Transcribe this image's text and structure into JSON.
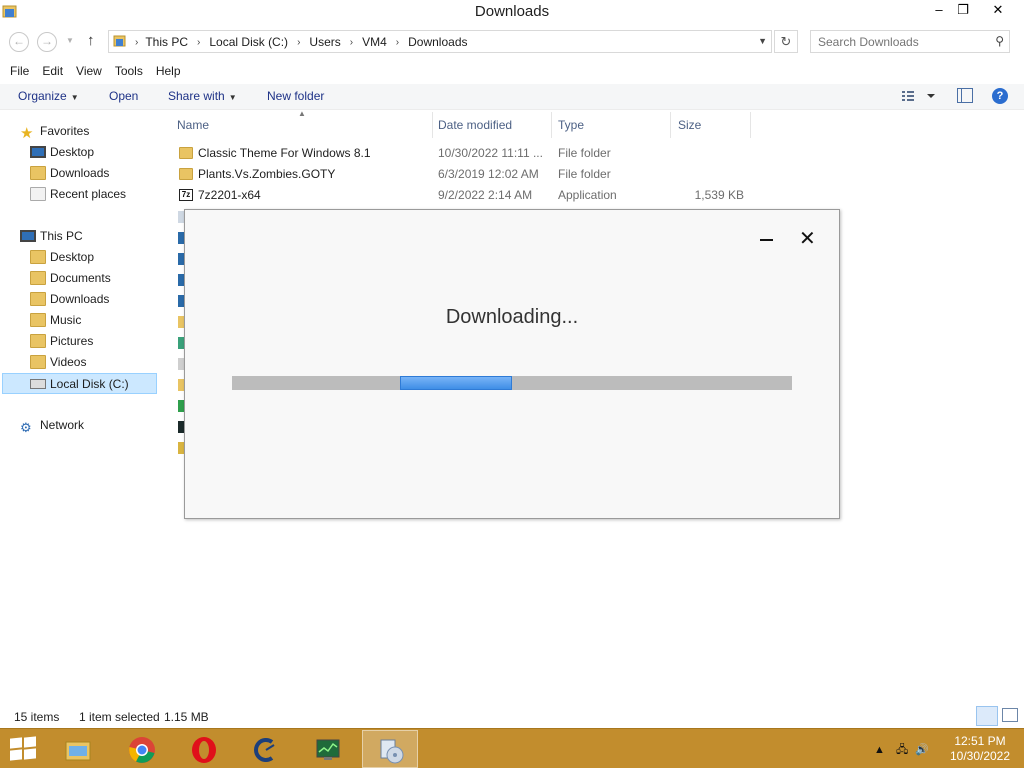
{
  "window": {
    "title": "Downloads",
    "controls": {
      "minimize": "–",
      "maximize": "❐",
      "close": "✕"
    }
  },
  "address_bar": {
    "breadcrumbs": [
      "This PC",
      "Local Disk (C:)",
      "Users",
      "VM4",
      "Downloads"
    ],
    "search_placeholder": "Search Downloads"
  },
  "menu": [
    "File",
    "Edit",
    "View",
    "Tools",
    "Help"
  ],
  "commands": {
    "organize": "Organize",
    "open": "Open",
    "share_with": "Share with",
    "new_folder": "New folder"
  },
  "nav": {
    "favorites": {
      "label": "Favorites",
      "items": [
        "Desktop",
        "Downloads",
        "Recent places"
      ]
    },
    "this_pc": {
      "label": "This PC",
      "items": [
        "Desktop",
        "Documents",
        "Downloads",
        "Music",
        "Pictures",
        "Videos",
        "Local Disk (C:)"
      ],
      "selected": "Local Disk (C:)"
    },
    "network": {
      "label": "Network"
    }
  },
  "file_list": {
    "columns": {
      "name": "Name",
      "date": "Date modified",
      "type": "Type",
      "size": "Size"
    },
    "rows": [
      {
        "name": "Classic Theme For Windows 8.1",
        "date": "10/30/2022 11:11 ...",
        "type": "File folder",
        "size": ""
      },
      {
        "name": "Plants.Vs.Zombies.GOTY",
        "date": "6/3/2019 12:02 AM",
        "type": "File folder",
        "size": ""
      },
      {
        "name": "7z2201-x64",
        "date": "9/2/2022 2:14 AM",
        "type": "Application",
        "size": "1,539 KB"
      }
    ]
  },
  "status": {
    "items": "15 items",
    "selected": "1 item selected",
    "size": "1.15 MB"
  },
  "dialog": {
    "message": "Downloading...",
    "progress_percent": 30
  },
  "taskbar": {
    "apps": [
      "file-explorer",
      "chrome",
      "opera",
      "ccleaner",
      "task-manager",
      "installer"
    ],
    "active_app": "installer",
    "time": "12:51 PM",
    "date": "10/30/2022"
  }
}
